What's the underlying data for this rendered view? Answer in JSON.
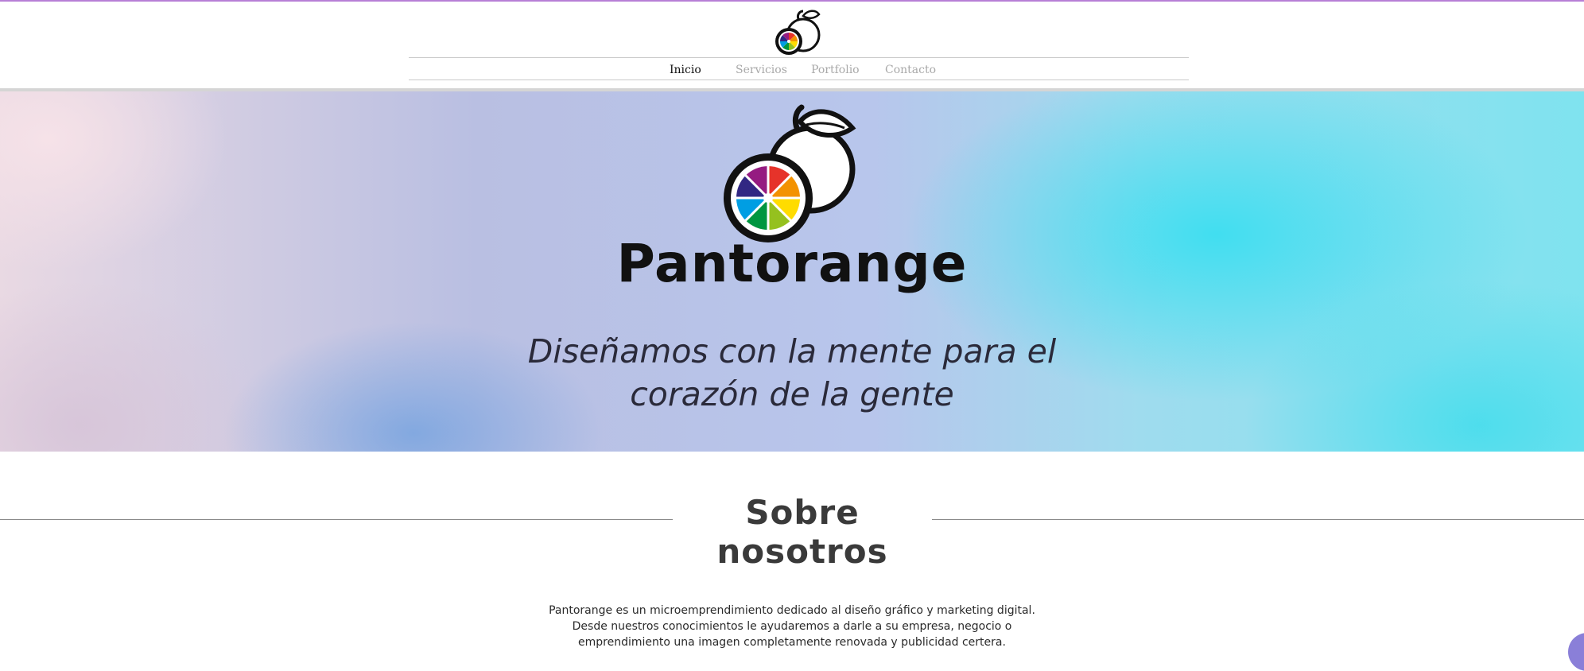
{
  "brand": {
    "name": "Pantorange",
    "tagline_line1": "Diseñamos con la mente para el",
    "tagline_line2": "corazón de la gente"
  },
  "nav": {
    "items": [
      {
        "label": "Inicio",
        "active": true
      },
      {
        "label": "Servicios",
        "active": false
      },
      {
        "label": "Portfolio",
        "active": false
      },
      {
        "label": "Contacto",
        "active": false
      }
    ]
  },
  "about": {
    "heading": "Sobre nosotros",
    "line1": "Pantorange es un microemprendimiento dedicado al diseño gráfico y marketing digital.",
    "line2": "Desde nuestros conocimientos le ayudaremos a darle a su empresa, negocio o",
    "line3": "emprendimiento una imagen completamente renovada y publicidad certera."
  },
  "colors": {
    "accent_top": "#b77fd6",
    "nav_active": "#111111",
    "nav_inactive": "#a9a9a9",
    "hero_cyan": "#3cdef0",
    "hero_pink": "#f6e2e8"
  },
  "icons": {
    "logo": "orange-rainbow-slice-logo",
    "chat": "chat-bubble-icon"
  }
}
